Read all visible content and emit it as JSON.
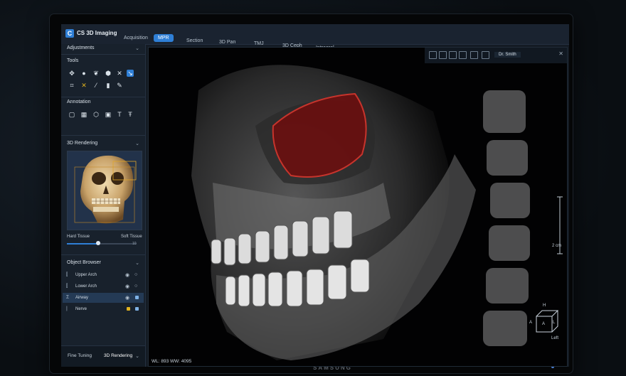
{
  "app": {
    "title": "CS 3D Imaging",
    "logo_glyph": "C",
    "accent": "#2f7fd6"
  },
  "tabs": [
    {
      "label": "Acquisition",
      "active": false
    },
    {
      "label": "MPR",
      "active": true
    },
    {
      "label": "Section",
      "active": false
    },
    {
      "label": "3D Pan",
      "active": false
    },
    {
      "label": "TMJ",
      "active": false
    },
    {
      "label": "3D Ceph",
      "active": false
    },
    {
      "label": "Intraoral",
      "active": false
    }
  ],
  "sidebar": {
    "adjustments_title": "Adjustments",
    "tools_title": "Tools",
    "tools_icons": [
      "move-icon",
      "circle-icon",
      "tooth-icon",
      "cube-icon",
      "cross-icon",
      "measure-icon",
      "crop-icon",
      "x-icon",
      "pipette-icon",
      "implant-icon",
      "pencil-icon"
    ],
    "annotation_title": "Annotation",
    "annotation_icons": [
      "rect-icon",
      "ruler-icon",
      "shape-icon",
      "comment-icon",
      "text-icon",
      "text-box-icon"
    ],
    "rendering_title": "3D Rendering",
    "hard_tissue_label": "Hard Tissue",
    "soft_tissue_label": "Soft Tissue",
    "tissue_slider_fraction": 0.45,
    "slider_value": "10",
    "object_browser_title": "Object Browser",
    "objects": [
      {
        "label": "Upper Arch",
        "icon": "arch-icon",
        "selected": false,
        "color": ""
      },
      {
        "label": "Lower Arch",
        "icon": "arch-icon",
        "selected": false,
        "color": ""
      },
      {
        "label": "Airway",
        "icon": "airway-icon",
        "selected": true,
        "color": "#7fb2e6"
      },
      {
        "label": "Nerve",
        "icon": "nerve-icon",
        "selected": false,
        "color": "#e0b21f"
      }
    ],
    "bottom_tabs": [
      {
        "label": "Fine Tuning",
        "active": false
      },
      {
        "label": "3D Rendering",
        "active": true
      }
    ]
  },
  "viewport": {
    "user": "Dr. Smith",
    "readout": "WL: 893 WW: 4095",
    "scale": "2 cm",
    "orientation": {
      "top": "H",
      "left": "A",
      "center": "A",
      "right": "L",
      "bottom": "Left"
    }
  }
}
